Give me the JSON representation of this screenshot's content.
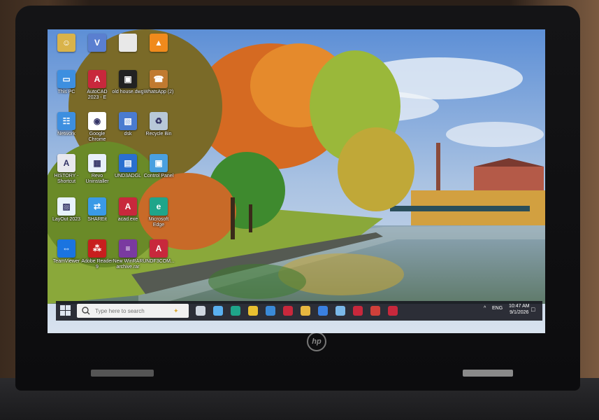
{
  "desktop": {
    "icons": [
      {
        "label": "",
        "name": "user-folder-icon",
        "color": "#d9b34a",
        "glyph": "☺"
      },
      {
        "label": "",
        "name": "vpn-app-icon",
        "color": "#5a7fd0",
        "glyph": "V"
      },
      {
        "label": "",
        "name": "blank-file-icon",
        "color": "#e8e8e8",
        "glyph": ""
      },
      {
        "label": "",
        "name": "vlc-icon",
        "color": "#f08a1c",
        "glyph": "▲"
      },
      {
        "label": "This PC",
        "name": "this-pc-icon",
        "color": "#3d8fe0",
        "glyph": "▭"
      },
      {
        "label": "AutoCAD 2023 - E",
        "name": "autocad-icon",
        "color": "#c8283c",
        "glyph": "A"
      },
      {
        "label": "old house.dwg",
        "name": "dwg-file-icon",
        "color": "#222222",
        "glyph": "▣"
      },
      {
        "label": "WhatsApp (2)",
        "name": "whatsapp-icon",
        "color": "#c07a30",
        "glyph": "☎"
      },
      {
        "label": "Network",
        "name": "network-icon",
        "color": "#3d8fe0",
        "glyph": "☷"
      },
      {
        "label": "Google Chrome",
        "name": "chrome-icon",
        "color": "#ffffff",
        "glyph": "◉"
      },
      {
        "label": "dsk",
        "name": "dsk-shortcut-icon",
        "color": "#4a7bd0",
        "glyph": "▧"
      },
      {
        "label": "Recycle Bin",
        "name": "recycle-bin-icon",
        "color": "#b8c8d8",
        "glyph": "♻"
      },
      {
        "label": "HISTORY - Shortcut",
        "name": "history-shortcut-icon",
        "color": "#e8e8ee",
        "glyph": "A"
      },
      {
        "label": "Revo Uninstaller",
        "name": "revo-uninstaller-icon",
        "color": "#e8f0fa",
        "glyph": "▦"
      },
      {
        "label": "UND3ADGL",
        "name": "und3adgl-icon",
        "color": "#2a6fd0",
        "glyph": "▤"
      },
      {
        "label": "Control Panel",
        "name": "control-panel-icon",
        "color": "#4aa0e0",
        "glyph": "▣"
      },
      {
        "label": "LayOut 2023",
        "name": "layout-icon",
        "color": "#e8f2fb",
        "glyph": "▨"
      },
      {
        "label": "SHAREit",
        "name": "shareit-icon",
        "color": "#3a9ae6",
        "glyph": "⇄"
      },
      {
        "label": "acad.exe",
        "name": "acad-exe-icon",
        "color": "#c8283c",
        "glyph": "A"
      },
      {
        "label": "Microsoft Edge",
        "name": "edge-icon",
        "color": "#1fa58a",
        "glyph": "e"
      },
      {
        "label": "TeamViewer",
        "name": "teamviewer-icon",
        "color": "#1a74e0",
        "glyph": "⇔"
      },
      {
        "label": "Adobe Reader 9",
        "name": "adobe-reader-icon",
        "color": "#c81e1e",
        "glyph": "⁂"
      },
      {
        "label": "New WinRAR archive.rar",
        "name": "winrar-icon",
        "color": "#7a3aa0",
        "glyph": "≡"
      },
      {
        "label": "UNDF3COM...",
        "name": "undf3com-icon",
        "color": "#c8283c",
        "glyph": "A"
      }
    ]
  },
  "taskbar": {
    "search_placeholder": "Type here to search",
    "apps": [
      {
        "name": "task-view-icon",
        "color": "#cfd6e0"
      },
      {
        "name": "copilot-icon",
        "color": "#5ab0f0"
      },
      {
        "name": "edge-taskbar-icon",
        "color": "#1fa58a"
      },
      {
        "name": "chrome-taskbar-icon",
        "color": "#e8c030"
      },
      {
        "name": "store-icon",
        "color": "#3a8ad8"
      },
      {
        "name": "autocad-taskbar-icon",
        "color": "#c8283c"
      },
      {
        "name": "explorer-taskbar-icon",
        "color": "#e8b840"
      },
      {
        "name": "media-player-icon",
        "color": "#3a80e0"
      },
      {
        "name": "network-taskbar-icon",
        "color": "#7ab8e8"
      },
      {
        "name": "autocad2-taskbar-icon",
        "color": "#c8283c"
      },
      {
        "name": "app-red-taskbar-icon",
        "color": "#d0403a"
      },
      {
        "name": "autocad3-taskbar-icon",
        "color": "#c8283c"
      }
    ],
    "tray": {
      "chevron": "^",
      "language": "ENG",
      "time": "10:47 AM",
      "date": "9/1/2026",
      "notification_glyph": "□"
    }
  },
  "laptop": {
    "brand": "hp"
  }
}
